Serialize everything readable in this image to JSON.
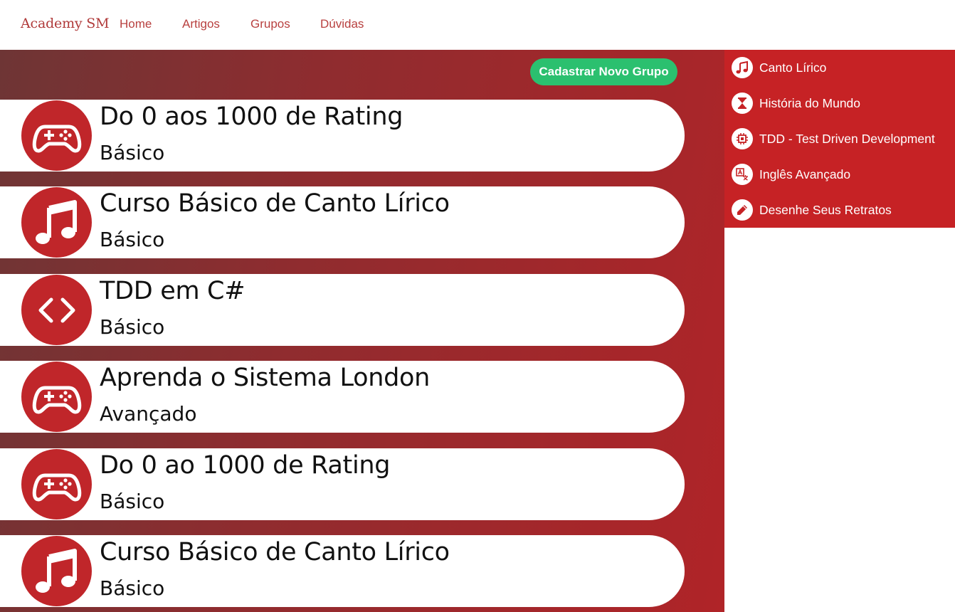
{
  "navbar": {
    "brand": "Academy SM",
    "links": [
      "Home",
      "Artigos",
      "Grupos",
      "Dúvidas"
    ]
  },
  "main": {
    "new_group_button": "Cadastrar Novo Grupo",
    "groups": [
      {
        "title": "Do 0 aos 1000 de Rating",
        "level": "Básico",
        "icon": "gamepad-icon"
      },
      {
        "title": "Curso Básico de Canto Lírico",
        "level": "Básico",
        "icon": "music-note-icon"
      },
      {
        "title": "TDD em C#",
        "level": "Básico",
        "icon": "code-icon"
      },
      {
        "title": "Aprenda o Sistema London",
        "level": "Avançado",
        "icon": "gamepad-icon"
      },
      {
        "title": "Do 0 ao 1000 de Rating",
        "level": "Básico",
        "icon": "gamepad-icon"
      },
      {
        "title": "Curso Básico de Canto Lírico",
        "level": "Básico",
        "icon": "music-note-icon"
      }
    ]
  },
  "sidebar": {
    "items": [
      {
        "label": "Canto Lírico",
        "icon": "music-note-icon"
      },
      {
        "label": "História do Mundo",
        "icon": "hourglass-icon"
      },
      {
        "label": "TDD - Test Driven Development",
        "icon": "chip-icon"
      },
      {
        "label": "Inglês Avançado",
        "icon": "translate-icon"
      },
      {
        "label": "Desenhe Seus Retratos",
        "icon": "pencil-icon"
      }
    ]
  },
  "colors": {
    "accent_red": "#c62225",
    "icon_red": "#c0262a",
    "button_green": "#2bc06f",
    "nav_text": "#b8403f"
  }
}
